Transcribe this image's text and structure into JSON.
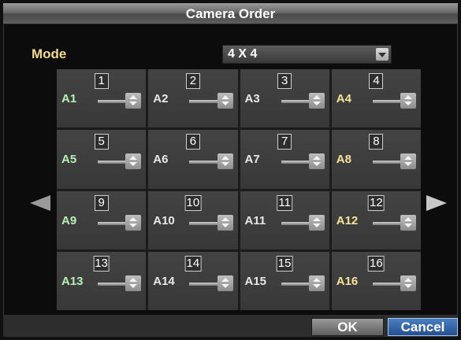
{
  "window": {
    "title": "Camera Order"
  },
  "mode": {
    "label": "Mode",
    "value": "4 X 4"
  },
  "cells": [
    {
      "number": "1",
      "camera": "A1"
    },
    {
      "number": "2",
      "camera": "A2"
    },
    {
      "number": "3",
      "camera": "A3"
    },
    {
      "number": "4",
      "camera": "A4"
    },
    {
      "number": "5",
      "camera": "A5"
    },
    {
      "number": "6",
      "camera": "A6"
    },
    {
      "number": "7",
      "camera": "A7"
    },
    {
      "number": "8",
      "camera": "A8"
    },
    {
      "number": "9",
      "camera": "A9"
    },
    {
      "number": "10",
      "camera": "A10"
    },
    {
      "number": "11",
      "camera": "A11"
    },
    {
      "number": "12",
      "camera": "A12"
    },
    {
      "number": "13",
      "camera": "A13"
    },
    {
      "number": "14",
      "camera": "A14"
    },
    {
      "number": "15",
      "camera": "A15"
    },
    {
      "number": "16",
      "camera": "A16"
    }
  ],
  "buttons": {
    "ok": "OK",
    "cancel": "Cancel"
  },
  "icons": {
    "prev": "left-arrow-icon",
    "next": "right-arrow-icon",
    "spin": "up-down-spinner-icon",
    "dropdown": "dropdown-arrow-icon"
  },
  "colors": {
    "accent": "#2a5a9e",
    "mode_label": "#f0dc8c"
  }
}
